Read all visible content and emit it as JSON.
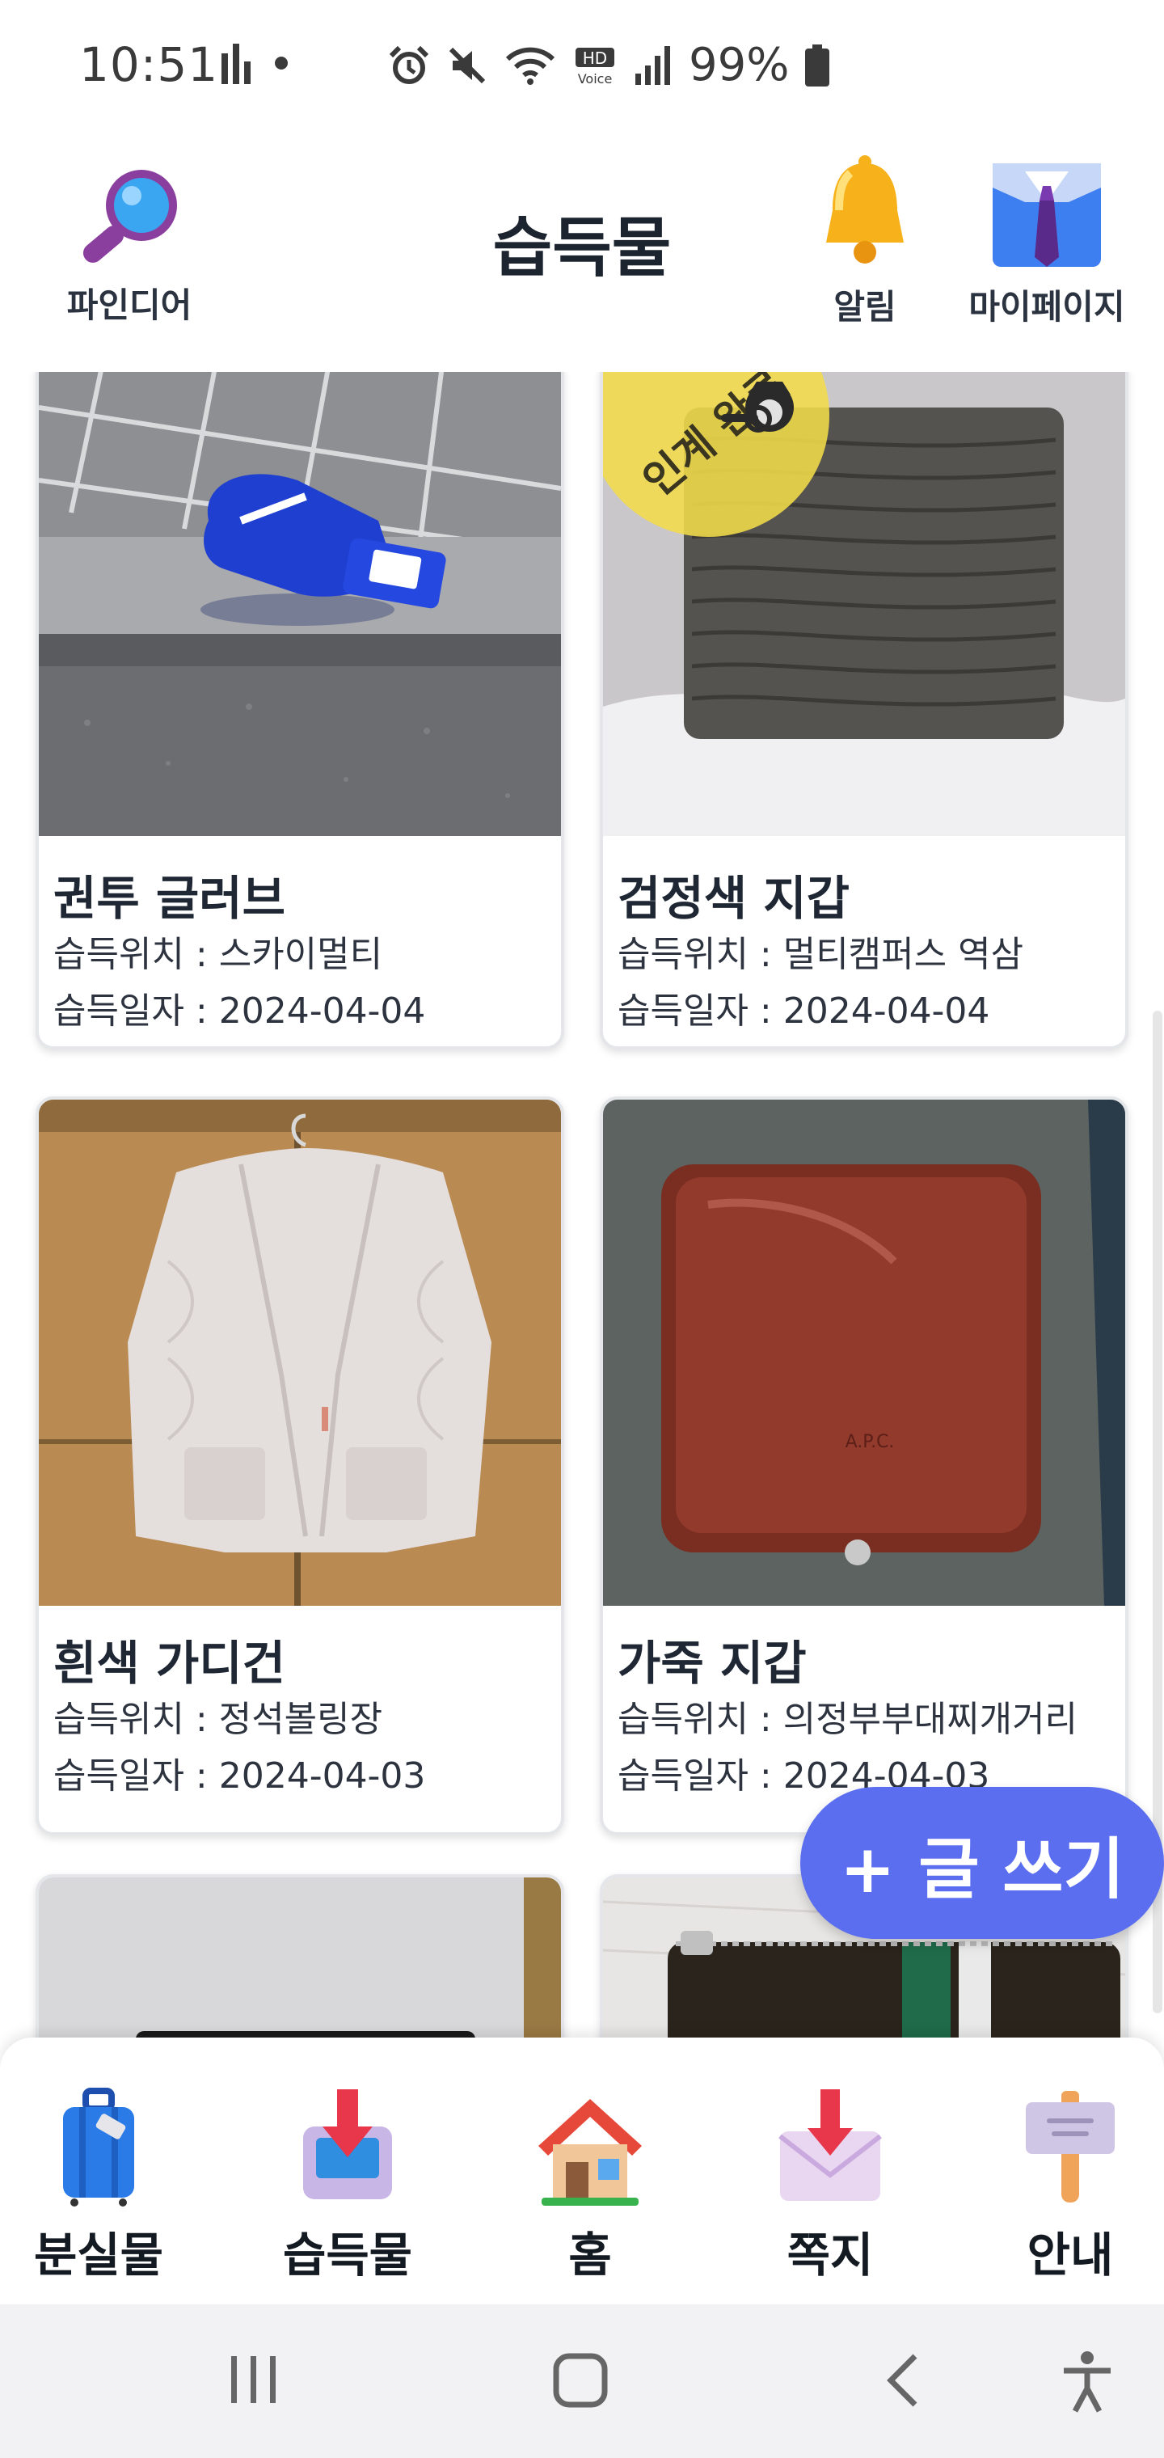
{
  "status_bar": {
    "time": "10:51",
    "battery_percent": "99%",
    "icons": [
      "bar-chart-icon",
      "dot-icon",
      "alarm-icon",
      "mute-icon",
      "wifi-icon",
      "hd-voice-icon",
      "signal-icon",
      "battery-icon"
    ]
  },
  "header": {
    "title": "습득물",
    "left_button": {
      "label": "파인디어",
      "icon": "magnifier-icon"
    },
    "right_buttons": [
      {
        "label": "알림",
        "icon": "bell-icon"
      },
      {
        "label": "마이페이지",
        "icon": "shirt-tie-icon"
      }
    ]
  },
  "items": [
    {
      "title": "권투 글러브",
      "location": "습득위치 : 스카이멀티",
      "date": "습득일자 : 2024-04-04",
      "badge": ""
    },
    {
      "title": "검정색 지갑",
      "location": "습득위치 : 멀티캠퍼스 역삼",
      "date": "습득일자 : 2024-04-04",
      "badge": "인계 완료"
    },
    {
      "title": "흰색 가디건",
      "location": "습득위치 : 정석볼링장",
      "date": "습득일자 : 2024-04-03",
      "badge": ""
    },
    {
      "title": "가죽 지갑",
      "location": "습득위치 : 의정부부대찌개거리",
      "date": "습득일자 : 2024-04-03",
      "badge": ""
    }
  ],
  "fab": {
    "label": "+ 글 쓰기"
  },
  "bottom_nav": [
    {
      "label": "분실물",
      "icon": "suitcase-icon"
    },
    {
      "label": "습득물",
      "icon": "inbox-tray-icon"
    },
    {
      "label": "홈",
      "icon": "house-icon"
    },
    {
      "label": "쪽지",
      "icon": "incoming-envelope-icon"
    },
    {
      "label": "안내",
      "icon": "placard-icon"
    }
  ],
  "system_nav": [
    "recent-apps-icon",
    "home-icon",
    "back-icon",
    "accessibility-icon"
  ],
  "colors": {
    "accent": "#5b6ef0",
    "badge": "#f2dc4a",
    "text": "#1c2430"
  }
}
